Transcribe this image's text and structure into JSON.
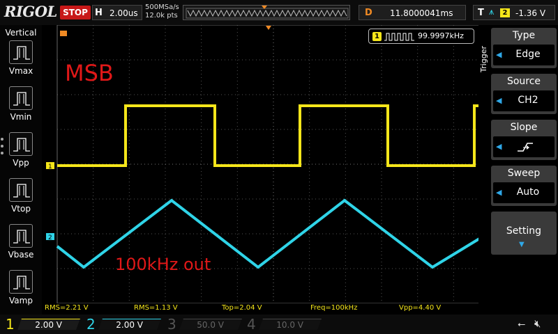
{
  "top": {
    "logo": "RIGOL",
    "run_state": "STOP",
    "timebase_key": "H",
    "timebase_value": "2.00us",
    "sample_rate": "500MSa/s",
    "mem_depth": "12.0k pts",
    "delay_key": "D",
    "delay_value": "11.8000041ms",
    "trigger_key": "T",
    "trigger_source_num": "2",
    "trigger_level": "-1.36 V"
  },
  "left": {
    "title": "Vertical",
    "items": [
      {
        "label": "Vmax",
        "icon": "vmax-icon"
      },
      {
        "label": "Vmin",
        "icon": "vmin-icon"
      },
      {
        "label": "Vpp",
        "icon": "vpp-icon"
      },
      {
        "label": "Vtop",
        "icon": "vtop-icon"
      },
      {
        "label": "Vbase",
        "icon": "vbase-icon"
      },
      {
        "label": "Vamp",
        "icon": "vamp-icon"
      }
    ]
  },
  "screen": {
    "annotation_top": "MSB",
    "annotation_bottom": "100kHz out",
    "freq_counter": "99.9997kHz",
    "ch1_marker": "1",
    "ch2_marker": "2"
  },
  "right": {
    "title": "Trigger",
    "menu": [
      {
        "label": "Type",
        "value": "Edge"
      },
      {
        "label": "Source",
        "value": "CH2"
      },
      {
        "label": "Slope",
        "value": ""
      },
      {
        "label": "Sweep",
        "value": "Auto"
      }
    ],
    "setting_label": "Setting"
  },
  "measurements": {
    "rms1": "RMS=2.21 V",
    "rms2": "RMS=1.13 V",
    "top": "Top=2.04 V",
    "freq": "Freq=100kHz",
    "vpp": "Vpp=4.40 V"
  },
  "channels": [
    {
      "num": "1",
      "scale": "2.00 V",
      "color": "#f5e61a"
    },
    {
      "num": "2",
      "scale": "2.00 V",
      "color": "#2fd4e8"
    },
    {
      "num": "3",
      "scale": "50.0 V",
      "color": "#c040c0"
    },
    {
      "num": "4",
      "scale": "10.0 V",
      "color": "#3a7ae8"
    }
  ],
  "colors": {
    "ch1": "#f5e61a",
    "ch2": "#2fd4e8",
    "accent_orange": "#f08a24",
    "annotation_red": "#e01818"
  }
}
